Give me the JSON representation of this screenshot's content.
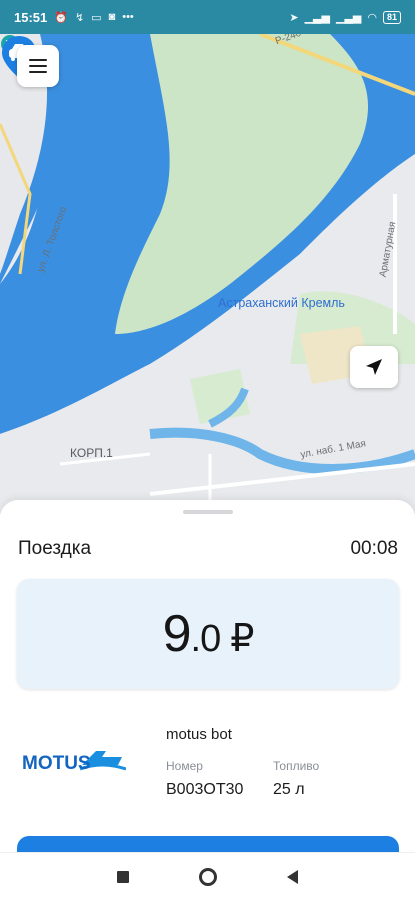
{
  "status_bar": {
    "time": "15:51",
    "more_indicator": "•••",
    "battery": "81"
  },
  "map": {
    "labels": {
      "kremlin": "Астраханский Кремль",
      "district": "КОРП.1",
      "street_tolstogo": "ул. Л. Толстого",
      "street_nab_1_maya": "ул. наб. 1 Мая",
      "street_armaturnaya": "Арматурная",
      "road_240": "Р-240"
    },
    "colors": {
      "water": "#3b8fe0",
      "park": "#cce5c6",
      "land": "#e9eaed"
    },
    "icons": {
      "menu": "menu-icon",
      "locate": "navigation-arrow-icon",
      "car": "car-marker-icon",
      "landmark": "landmark-icon"
    }
  },
  "trip": {
    "title": "Поездка",
    "duration": "00:08",
    "price_int": "9",
    "price_dec": ".0",
    "currency": "₽"
  },
  "vehicle": {
    "logo_text": "MOTUS",
    "name": "motus bot",
    "number_label": "Номер",
    "number_value": "В003ОТ30",
    "fuel_label": "Топливо",
    "fuel_value": "25 л"
  },
  "accent_color": "#1d7fe2"
}
